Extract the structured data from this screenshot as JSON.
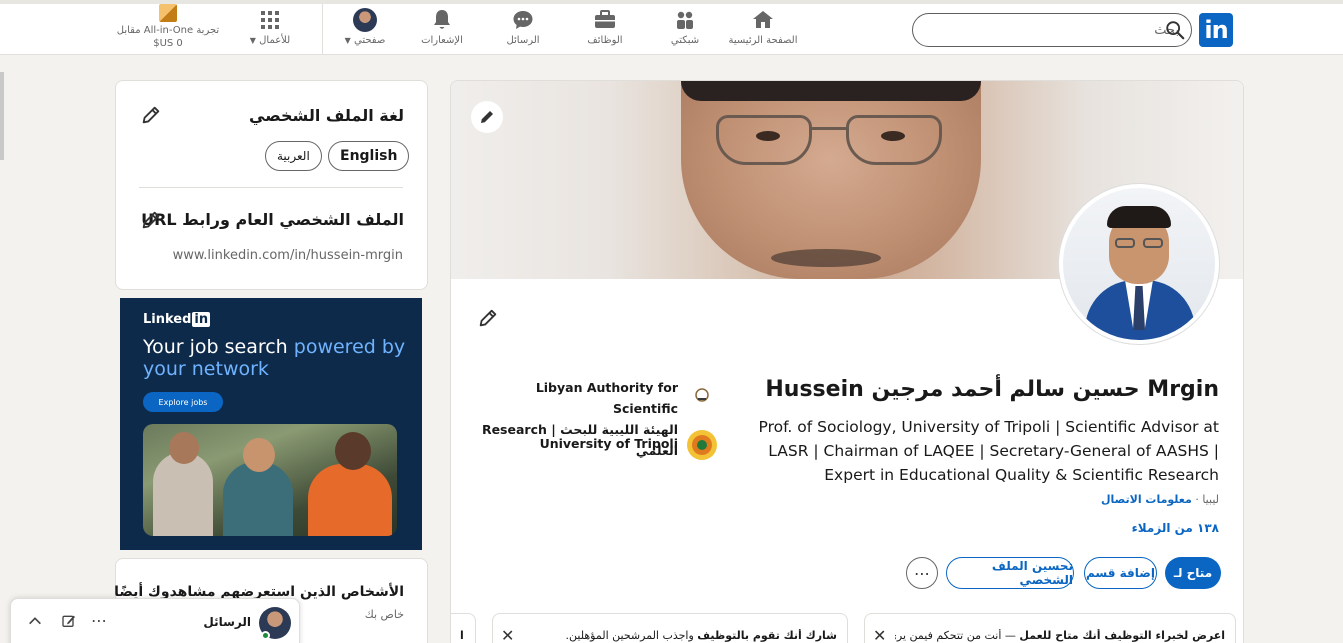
{
  "nav": {
    "search_placeholder": "بحث",
    "items": [
      {
        "label": "الصفحة الرئيسية",
        "icon": "home-icon"
      },
      {
        "label": "شبكتي",
        "icon": "network-icon"
      },
      {
        "label": "الوظائف",
        "icon": "briefcase-icon"
      },
      {
        "label": "الرسائل",
        "icon": "messaging-icon"
      },
      {
        "label": "الإشعارات",
        "icon": "bell-icon"
      },
      {
        "label": "صفحتي",
        "icon": "me-avatar"
      },
      {
        "label": "للأعمال",
        "icon": "grid-icon"
      }
    ],
    "premium_line1": "تجربة All-in-One مقابل",
    "premium_line2": "0 US$"
  },
  "sidebar": {
    "language_title": "لغة الملف الشخصي",
    "lang_english": "English",
    "lang_arabic": "العربية",
    "url_title": "الملف الشخصي العام ورابط URL",
    "url_value": "www.linkedin.com/in/hussein-mrgin",
    "viewers_title": "الأشخاص الذين استعرضهم مشاهدوك أيضًا",
    "viewers_sub": "خاص بك"
  },
  "ad": {
    "brand": "Linked",
    "brand_box": "in",
    "headline_1": "Your job search ",
    "headline_hl": "powered by your network",
    "cta": "Explore jobs"
  },
  "profile": {
    "name": "Hussein حسين سالم أحمد مرجين Mrgin",
    "headline": "Prof.  of Sociology, University of Tripoli | Scientific Advisor at LASR | Chairman of LAQEE | Secretary-General of AASHS | Expert in Educational  Quality & Scientific Research",
    "location": "ليبيا",
    "contact": "معلومات الاتصال",
    "connections": "١٣٨ من الزملاء",
    "org1_line1": "Libyan Authority for Scientific",
    "org1_line2": "Research | الهيئة الليبية للبحث العلمي",
    "org2": "University of Tripoli",
    "btn_open": "متاح لـ",
    "btn_add_section": "إضافة قسم",
    "btn_improve": "تحسين الملف الشخصي",
    "card1_bold": "اعرض لخبراء التوظيف أنك متاح للعمل",
    "card1_rest": " — أنت من تتحكم فيمن يرى",
    "card2_bold": "شارك أنك تقوم بالتوظيف",
    "card2_rest": " واجذب المرشحين المؤهلين.",
    "card3_partial": "ا"
  },
  "messaging": {
    "label": "الرسائل"
  }
}
